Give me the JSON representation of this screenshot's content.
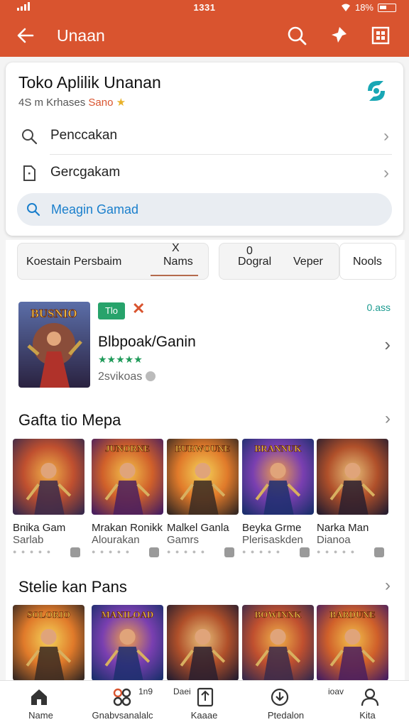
{
  "status": {
    "time": "1331",
    "battery": "18%"
  },
  "appbar": {
    "title": "Unaan",
    "back_icon": "arrow-left-icon",
    "actions": [
      "search-icon",
      "pin-icon",
      "grid-icon"
    ]
  },
  "app": {
    "name": "Toko Aplilik Unanan",
    "meta_prefix": "4S m Krhases",
    "meta_highlight": "Sano",
    "rating_star": "★",
    "menu": [
      {
        "label": "Penccakan",
        "icon": "search-icon"
      },
      {
        "label": "Gercgakam",
        "icon": "document-icon"
      }
    ],
    "search_placeholder": "Meagin Gamad"
  },
  "chips": [
    {
      "label": "Koestain Persbaim"
    },
    {
      "label": "Nams",
      "top_label": "X"
    },
    {
      "label": "Dogral",
      "top_label": "0"
    },
    {
      "label": "Veper"
    },
    {
      "label": "Nools"
    }
  ],
  "featured": {
    "badge": "Tlo",
    "x_label": "✕",
    "size": "0.ass",
    "title": "Blbpoak/Ganin",
    "stars": "★★★★★",
    "meta": "2svikoas",
    "cover_text": "BUSNIO"
  },
  "sections": [
    {
      "title": "Gafta tio Mepa",
      "tiles": [
        {
          "l1": "Bnika Gam",
          "l2": "Sarlab",
          "art_text": ""
        },
        {
          "l1": "Mrakan Ronikk",
          "l2": "Alourakan",
          "art_text": "JUNORNE"
        },
        {
          "l1": "Malkel Ganla",
          "l2": "Gamrs",
          "art_text": "BURWOUNE"
        },
        {
          "l1": "Beyka Grme",
          "l2": "Plerisaskden",
          "art_text": "BRANNUK"
        },
        {
          "l1": "Narka Man",
          "l2": "Dianoa",
          "art_text": ""
        }
      ]
    },
    {
      "title": "Stelie kan Pans",
      "tiles": [
        {
          "art_text": "SOLORIO"
        },
        {
          "art_text": "MANILOAD"
        },
        {
          "art_text": ""
        },
        {
          "art_text": "BOWINNK"
        },
        {
          "art_text": "BARDUNE"
        }
      ]
    }
  ],
  "bottomnav": [
    {
      "label": "Name",
      "icon": "home-icon"
    },
    {
      "label": "Gnabvsanalalc",
      "icon": "games-icon",
      "extra": "1n9"
    },
    {
      "label": "Kaaae",
      "icon": "apps-icon",
      "extra": "Daei"
    },
    {
      "label": "Ptedalon",
      "icon": "download-icon"
    },
    {
      "label": "Kita",
      "icon": "person-icon",
      "extra": "ioav"
    }
  ],
  "colors": {
    "brand": "#d9542f",
    "accent_green": "#27a36b",
    "link_blue": "#1a7fcc"
  }
}
